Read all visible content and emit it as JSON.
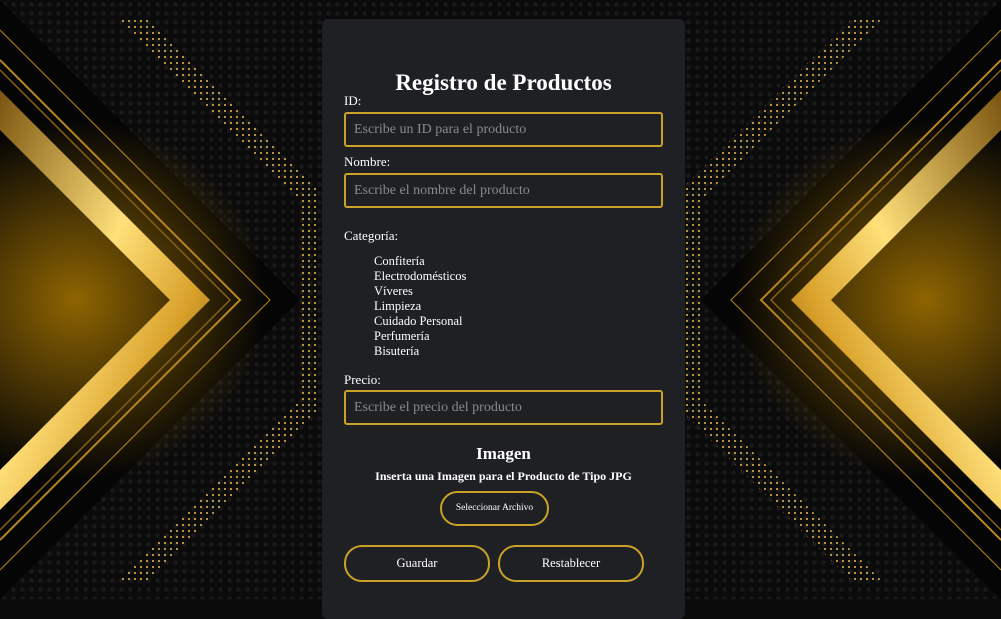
{
  "form": {
    "title": "Registro de Productos",
    "id_label": "ID:",
    "id_placeholder": "Escribe un ID para el producto",
    "id_value": "",
    "name_label": "Nombre:",
    "name_placeholder": "Escribe el nombre del producto",
    "name_value": "",
    "category_label": "Categoría:",
    "categories": [
      "Confitería",
      "Electrodomésticos",
      "Víveres",
      "Limpieza",
      "Cuidado Personal",
      "Perfumería",
      "Bisutería"
    ],
    "price_label": "Precio:",
    "price_placeholder": "Escribe el precio del producto",
    "price_value": "",
    "image_title": "Imagen",
    "image_subtitle": "Inserta una Imagen para el Producto de Tipo JPG",
    "file_button": "Seleccionar Archivo",
    "save_button": "Guardar",
    "reset_button": "Restablecer"
  },
  "theme": {
    "card_bg": "#1e2023",
    "accent_gold": "#c9a227",
    "page_bg": "#0b0b0b"
  }
}
